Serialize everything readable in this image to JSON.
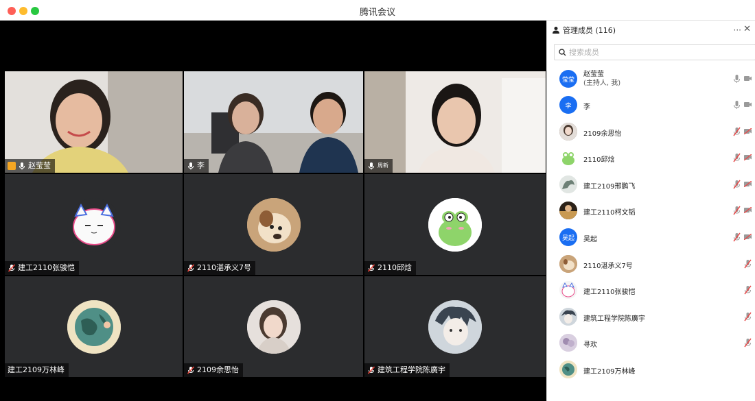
{
  "window": {
    "title": "腾讯会议"
  },
  "tiles": [
    {
      "name": "赵莹莹",
      "host": true,
      "mic": "on"
    },
    {
      "name": "李",
      "mic": "on"
    },
    {
      "name": "周新",
      "mic": "on"
    },
    {
      "name": "建工2110张骏恺",
      "mic": "muted"
    },
    {
      "name": "2110湛承义7号",
      "mic": "muted"
    },
    {
      "name": "2110邱焓",
      "mic": "muted"
    },
    {
      "name": "建工2109万林峰",
      "mic": "none"
    },
    {
      "name": "2109余思怡",
      "mic": "muted"
    },
    {
      "name": "建筑工程学院陈廣宇",
      "mic": "muted"
    }
  ],
  "panel": {
    "title": "管理成员 (116)",
    "more": "···",
    "close": "✕",
    "search_placeholder": "搜索成员",
    "members": [
      {
        "avatar_text": "莹莹",
        "name": "赵莹莹",
        "sub": "(主持人, 我)",
        "mic": "on",
        "cam": "on"
      },
      {
        "avatar_text": "李",
        "name": "李",
        "mic": "on",
        "cam": "on"
      },
      {
        "name": "2109余思怡",
        "mic": "muted",
        "cam": "off"
      },
      {
        "name": "2110邱焓",
        "mic": "muted",
        "cam": "off"
      },
      {
        "name": "建工2109邢鹏飞",
        "mic": "muted",
        "cam": "off"
      },
      {
        "name": "建工2110柯文韬",
        "mic": "muted",
        "cam": "off"
      },
      {
        "avatar_text": "吴起",
        "name": "吴起",
        "mic": "muted",
        "cam": "off"
      },
      {
        "name": "2110湛承义7号",
        "mic": "muted"
      },
      {
        "name": "建工2110张骏恺",
        "mic": "muted"
      },
      {
        "name": "建筑工程学院陈廣宇",
        "mic": "muted"
      },
      {
        "name": "寻欢",
        "mic": "muted"
      },
      {
        "name": "建工2109万林峰"
      }
    ]
  }
}
